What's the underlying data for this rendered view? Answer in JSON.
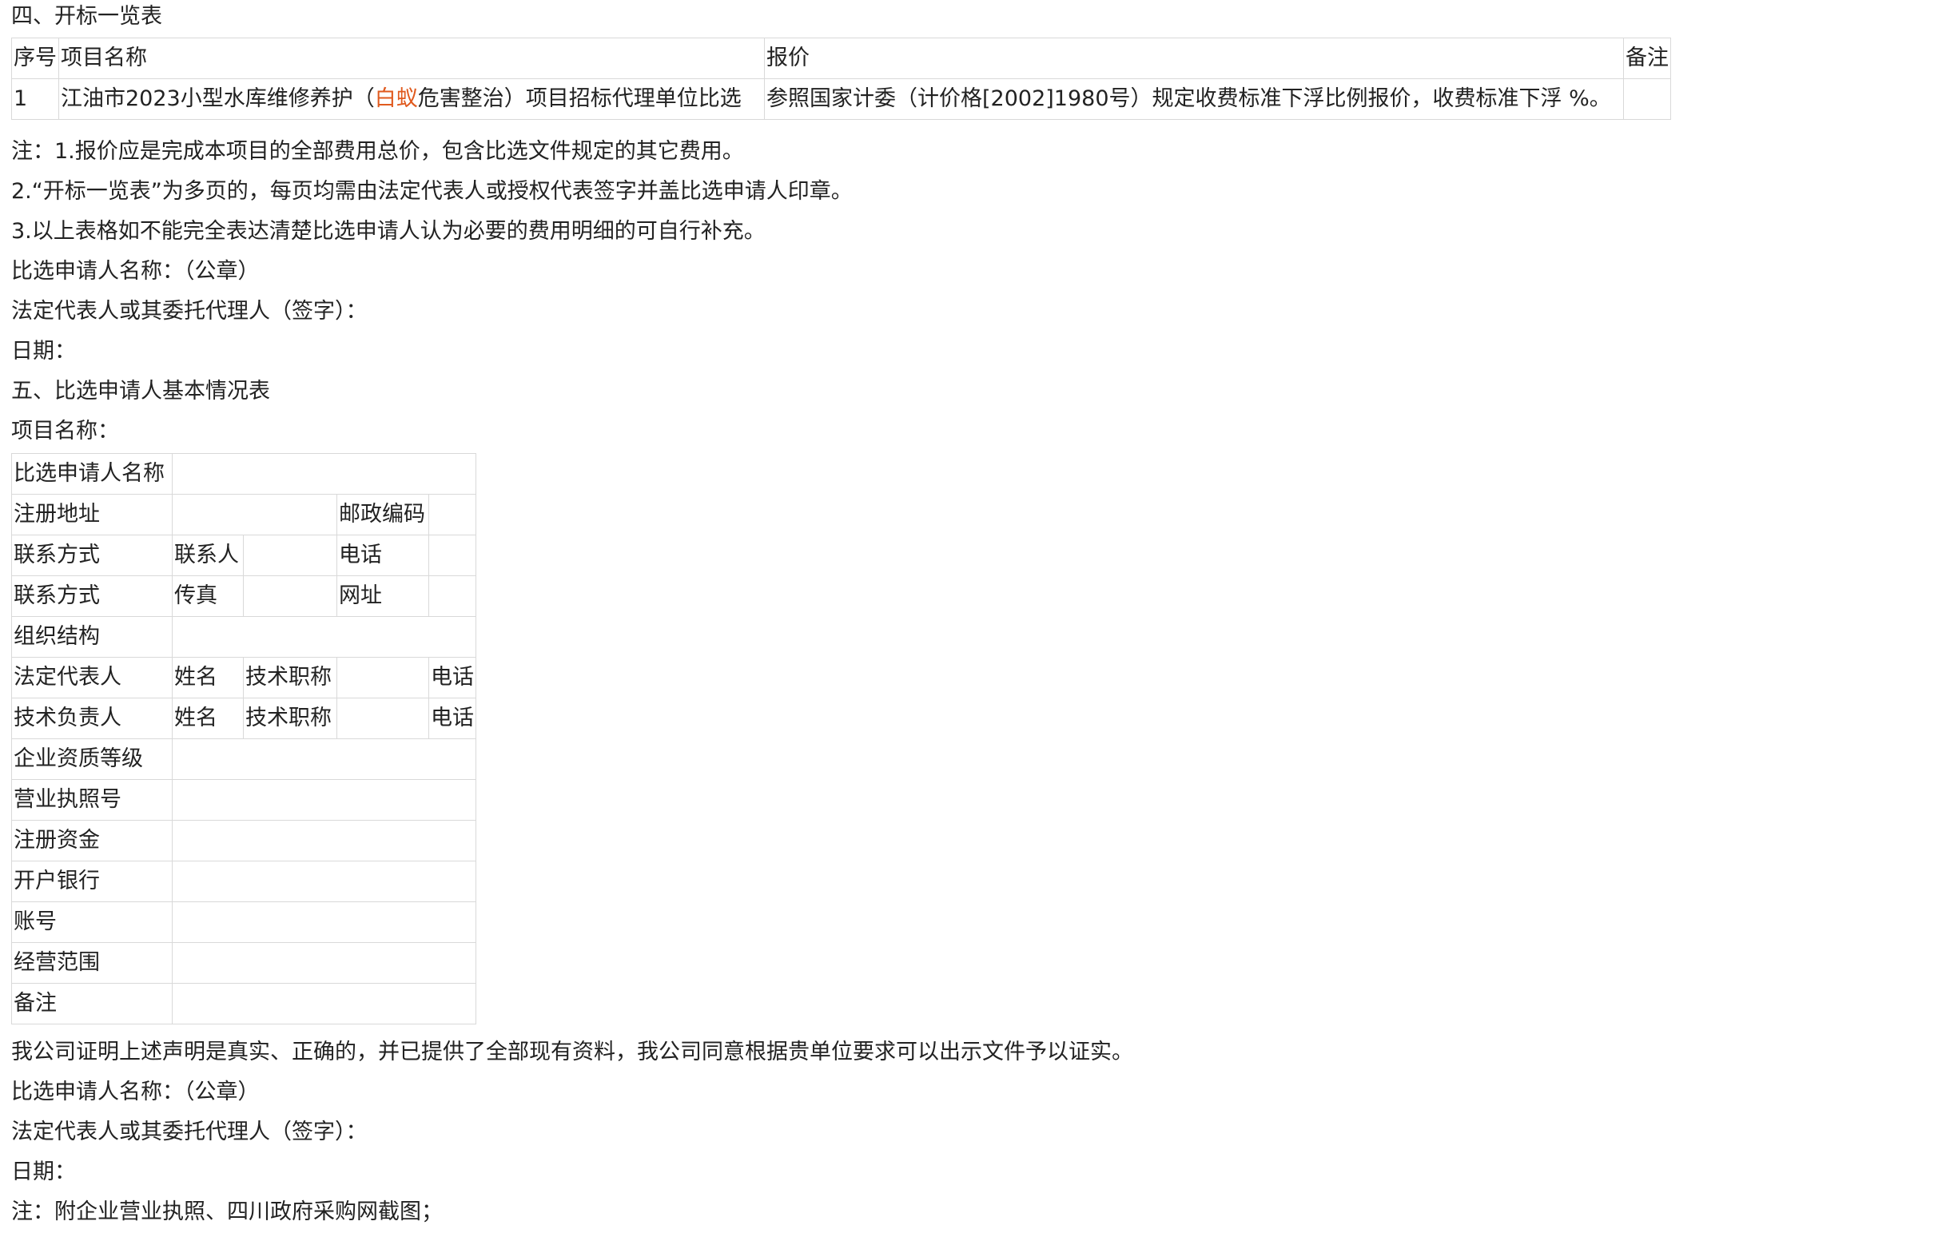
{
  "section4": {
    "title": "四、开标一览表",
    "table": {
      "headers": [
        "序号",
        "项目名称",
        "报价",
        "备注"
      ],
      "row": {
        "index": "1",
        "name_prefix": "江油市2023小型水库维修养护（",
        "name_highlight": "白蚁",
        "name_suffix": "危害整治）项目招标代理单位比选",
        "price": "参照国家计委（计价格[2002]1980号）规定收费标准下浮比例报价，收费标准下浮 %。",
        "remark": ""
      },
      "highlight_color": "#e05a1e"
    },
    "notes": [
      "注：1.报价应是完成本项目的全部费用总价，包含比选文件规定的其它费用。",
      "2.“开标一览表”为多页的，每页均需由法定代表人或授权代表签字并盖比选申请人印章。",
      "3.以上表格如不能完全表达清楚比选申请人认为必要的费用明细的可自行补充。"
    ],
    "applicant_name": "比选申请人名称：（公章）",
    "representative": "法定代表人或其委托代理人（签字）：",
    "date": "日期："
  },
  "section5": {
    "title": "五、比选申请人基本情况表",
    "project_name_label": "项目名称：",
    "table": {
      "applicant": "比选申请人名称",
      "address": "注册地址",
      "postcode": "邮政编码",
      "contact_label": "联系方式",
      "contact_person": "联系人",
      "phone": "电话",
      "fax": "传真",
      "website": "网址",
      "organization": "组织结构",
      "legal_rep": "法定代表人",
      "tech_lead": "技术负责人",
      "name": "姓名",
      "tech_title": "技术职称",
      "qualification": "企业资质等级",
      "license_no": "营业执照号",
      "registered_capital": "注册资金",
      "bank": "开户银行",
      "account": "账号",
      "business_scope": "经营范围",
      "remark": "备注"
    },
    "declaration": "我公司证明上述声明是真实、正确的，并已提供了全部现有资料，我公司同意根据贵单位要求可以出示文件予以证实。",
    "applicant_name": "比选申请人名称：（公章）",
    "representative": "法定代表人或其委托代理人（签字）：",
    "date": "日期：",
    "attachment_note": "注：附企业营业执照、四川政府采购网截图；"
  }
}
